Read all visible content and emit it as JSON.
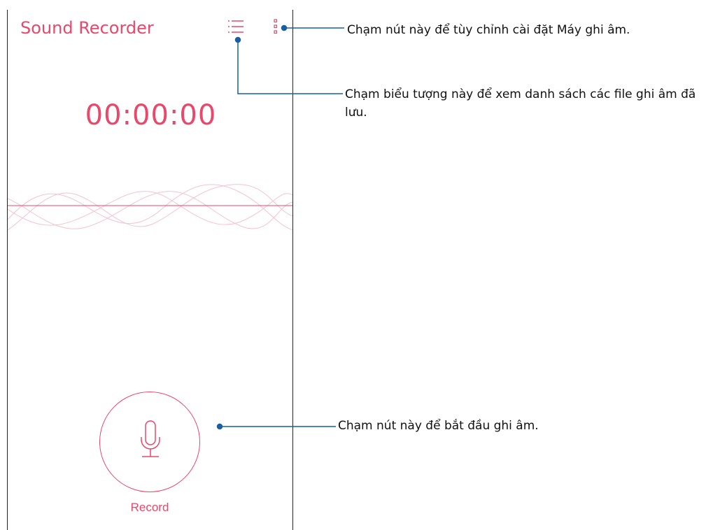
{
  "app": {
    "title": "Sound Recorder",
    "list_icon": "list-icon",
    "more_icon": "more-vert-icon",
    "accent_color": "#e8486a"
  },
  "recorder": {
    "timer": "00:00:00",
    "record_label": "Record",
    "record_icon": "microphone-icon"
  },
  "callouts": {
    "settings_note": "Chạm nút này để tùy chỉnh cài đặt Máy ghi âm.",
    "list_note": "Chạm biểu tượng này để xem danh sách các file ghi âm đã lưu.",
    "record_note": "Chạm nút này để bắt đầu ghi âm.",
    "line_color": "#1a5fa0"
  }
}
